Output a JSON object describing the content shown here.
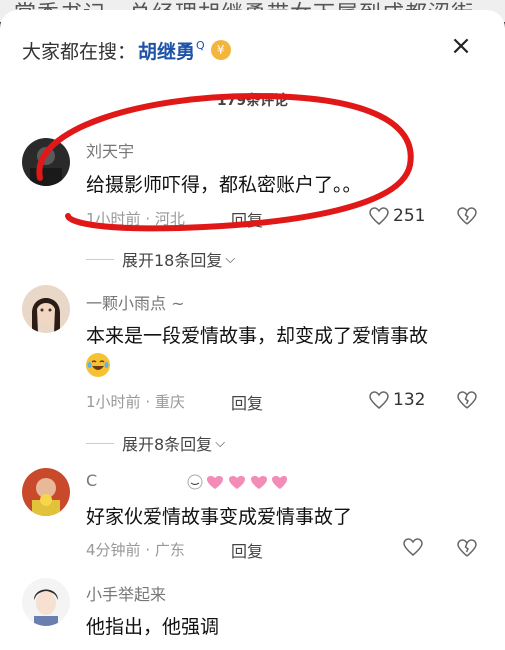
{
  "background_text": "赏秀书记，总经理胡继勇带女下属到成都涩街",
  "search": {
    "prefix": "大家都在搜：",
    "term": "胡继勇",
    "mini": "Q",
    "icon_glyph": "¥"
  },
  "close_icon": "×",
  "comment_count": "179条评论",
  "comments": [
    {
      "name": "刘天宇",
      "text": "给摄影师吓得，都私密账户了。。",
      "time": "1小时前",
      "location": "河北",
      "likes": "251",
      "expand": "展开18条回复"
    },
    {
      "name": "一颗小雨点 ~",
      "text": "本来是一段爱情故事，却变成了爱情事故",
      "time": "1小时前",
      "location": "重庆",
      "likes": "132",
      "expand": "展开8条回复"
    },
    {
      "name": "C",
      "text": "好家伙爱情故事变成爱情事故了",
      "time": "4分钟前",
      "location": "广东",
      "likes": ""
    },
    {
      "name": "小手举起来",
      "text": "他指出，他强调"
    }
  ],
  "reply_label": "回复",
  "dot": "·",
  "chevron": "⌵",
  "colors": {
    "search_term": "#1e53a8",
    "annotation_red": "#e01818",
    "hearts": "#f48cb8"
  }
}
